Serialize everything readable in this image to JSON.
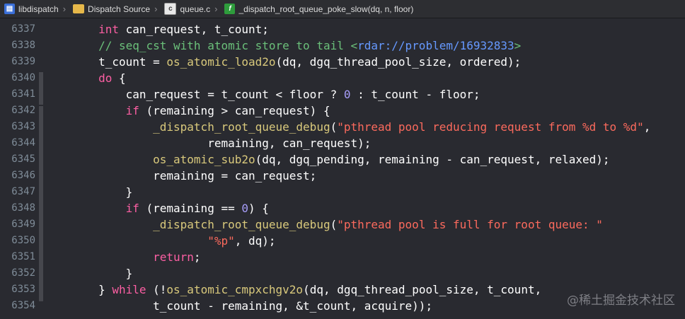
{
  "breadcrumb": [
    {
      "label": "libdispatch",
      "icon": "project-icon"
    },
    {
      "label": "Dispatch Source",
      "icon": "folder-icon"
    },
    {
      "label": "queue.c",
      "icon": "c-file-icon"
    },
    {
      "label": "_dispatch_root_queue_poke_slow(dq, n, floor)",
      "icon": "function-icon"
    }
  ],
  "line_numbers": [
    "6337",
    "6338",
    "6339",
    "6340",
    "6341",
    "6342",
    "6343",
    "6344",
    "6345",
    "6346",
    "6347",
    "6348",
    "6349",
    "6350",
    "6351",
    "6352",
    "6353",
    "6354"
  ],
  "code_lines": [
    [
      {
        "t": "        "
      },
      {
        "t": "int",
        "c": "kw"
      },
      {
        "t": " can_request, t_count;"
      }
    ],
    [
      {
        "t": "        "
      },
      {
        "t": "// seq_cst with atomic store to tail <",
        "c": "cm"
      },
      {
        "t": "rdar://problem/16932833",
        "c": "lk"
      },
      {
        "t": ">",
        "c": "cm"
      }
    ],
    [
      {
        "t": "        t_count = "
      },
      {
        "t": "os_atomic_load2o",
        "c": "fn"
      },
      {
        "t": "(dq, dgq_thread_pool_size, ordered);"
      }
    ],
    [
      {
        "t": "        "
      },
      {
        "t": "do",
        "c": "kw"
      },
      {
        "t": " {"
      }
    ],
    [
      {
        "t": "            can_request = t_count < floor ? "
      },
      {
        "t": "0",
        "c": "num"
      },
      {
        "t": " : t_count - floor;"
      }
    ],
    [
      {
        "t": "            "
      },
      {
        "t": "if",
        "c": "kw"
      },
      {
        "t": " (remaining > can_request) {"
      }
    ],
    [
      {
        "t": "                "
      },
      {
        "t": "_dispatch_root_queue_debug",
        "c": "fn"
      },
      {
        "t": "("
      },
      {
        "t": "\"pthread pool reducing request from %d to %d\"",
        "c": "str"
      },
      {
        "t": ","
      }
    ],
    [
      {
        "t": "                        remaining, can_request);"
      }
    ],
    [
      {
        "t": "                "
      },
      {
        "t": "os_atomic_sub2o",
        "c": "fn"
      },
      {
        "t": "(dq, dgq_pending, remaining - can_request, relaxed);"
      }
    ],
    [
      {
        "t": "                remaining = can_request;"
      }
    ],
    [
      {
        "t": "            }"
      }
    ],
    [
      {
        "t": "            "
      },
      {
        "t": "if",
        "c": "kw"
      },
      {
        "t": " (remaining == "
      },
      {
        "t": "0",
        "c": "num"
      },
      {
        "t": ") {"
      }
    ],
    [
      {
        "t": "                "
      },
      {
        "t": "_dispatch_root_queue_debug",
        "c": "fn"
      },
      {
        "t": "("
      },
      {
        "t": "\"pthread pool is full for root queue: \"",
        "c": "str"
      }
    ],
    [
      {
        "t": "                        "
      },
      {
        "t": "\"%p\"",
        "c": "str"
      },
      {
        "t": ", dq);"
      }
    ],
    [
      {
        "t": "                "
      },
      {
        "t": "return",
        "c": "kw"
      },
      {
        "t": ";"
      }
    ],
    [
      {
        "t": "            }"
      }
    ],
    [
      {
        "t": "        } "
      },
      {
        "t": "while",
        "c": "kw"
      },
      {
        "t": " (!"
      },
      {
        "t": "os_atomic_cmpxchgv2o",
        "c": "fn"
      },
      {
        "t": "(dq, dgq_thread_pool_size, t_count,"
      }
    ],
    [
      {
        "t": "                t_count - remaining, &t_count, acquire));"
      }
    ]
  ],
  "watermark": "@稀土掘金技术社区",
  "colors": {
    "background": "#292a30",
    "keyword": "#fc5fa3",
    "comment": "#6bc07a",
    "link": "#6699ff",
    "function": "#d9c97c",
    "number": "#a79df9",
    "string": "#fc6a5d"
  }
}
